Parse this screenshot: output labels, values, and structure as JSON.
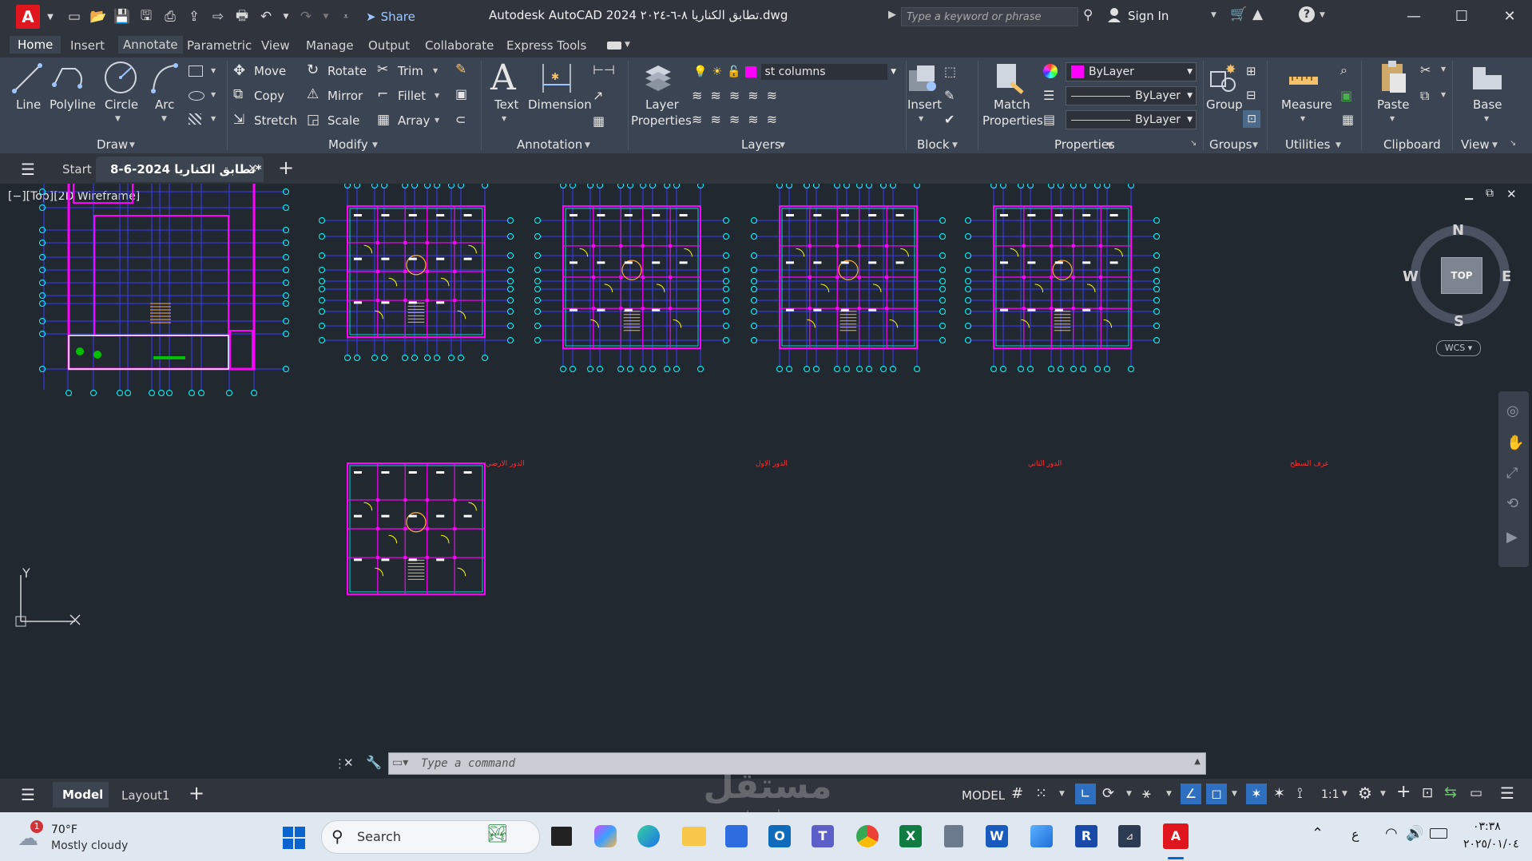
{
  "titlebar": {
    "app_letter": "A",
    "share_label": "Share",
    "title": "Autodesk AutoCAD 2024  تطابق الكناريا ٨-٦-٢٠٢٤.dwg",
    "search_placeholder": "Type a keyword or phrase",
    "signin_label": "Sign In"
  },
  "menu_tabs": [
    "Home",
    "Insert",
    "Annotate",
    "Parametric",
    "View",
    "Manage",
    "Output",
    "Collaborate",
    "Express Tools"
  ],
  "ribbon": {
    "draw": {
      "line": "Line",
      "polyline": "Polyline",
      "circle": "Circle",
      "arc": "Arc",
      "title": "Draw"
    },
    "modify": {
      "move": "Move",
      "rotate": "Rotate",
      "trim": "Trim",
      "copy": "Copy",
      "mirror": "Mirror",
      "fillet": "Fillet",
      "stretch": "Stretch",
      "scale": "Scale",
      "array": "Array",
      "title": "Modify"
    },
    "annotation": {
      "text": "Text",
      "dimension": "Dimension",
      "title": "Annotation"
    },
    "layers": {
      "properties_1": "Layer",
      "properties_2": "Properties",
      "current_layer": "st columns",
      "title": "Layers"
    },
    "block": {
      "insert": "Insert",
      "title": "Block"
    },
    "properties": {
      "match_1": "Match",
      "match_2": "Properties",
      "color": "ByLayer",
      "linetype": "ByLayer",
      "lineweight": "ByLayer",
      "title": "Properties"
    },
    "groups": {
      "group": "Group",
      "title": "Groups"
    },
    "utilities": {
      "measure": "Measure",
      "title": "Utilities"
    },
    "clipboard": {
      "paste": "Paste",
      "title": "Clipboard"
    },
    "view": {
      "base": "Base",
      "title": "View"
    }
  },
  "doc_tabs": {
    "start": "Start",
    "active": "8-6-2024 تطابق الكناريا*"
  },
  "viewport": {
    "label": "[−][Top][2D Wireframe]",
    "viewcube": {
      "n": "N",
      "s": "S",
      "e": "E",
      "w": "W",
      "top": "TOP",
      "wcs": "WCS"
    },
    "ucs": {
      "y": "Y"
    },
    "plan_labels": [
      "الدور الارضي",
      "الدور الاول",
      "الدور الثاني",
      "غرف السطح"
    ]
  },
  "command": {
    "placeholder": "Type a command"
  },
  "status": {
    "model_tab": "Model",
    "layout_tab": "Layout1",
    "model_btn": "MODEL",
    "scale": "1:1"
  },
  "watermark": {
    "line1": "مستقل",
    "line2": "mostaql.com"
  },
  "taskbar": {
    "weather_badge": "1",
    "temp": "70°F",
    "weather": "Mostly cloudy",
    "search": "Search",
    "lang": "ع",
    "time": "٠٣:٣٨",
    "date": "٢٠٢٥/٠١/٠٤"
  },
  "colors": {
    "magenta": "#ff00ff",
    "blue": "#3a3aff",
    "cyan": "#00ffff",
    "green": "#00c000",
    "yellow": "#ffff00",
    "accent": "#e0161f"
  }
}
